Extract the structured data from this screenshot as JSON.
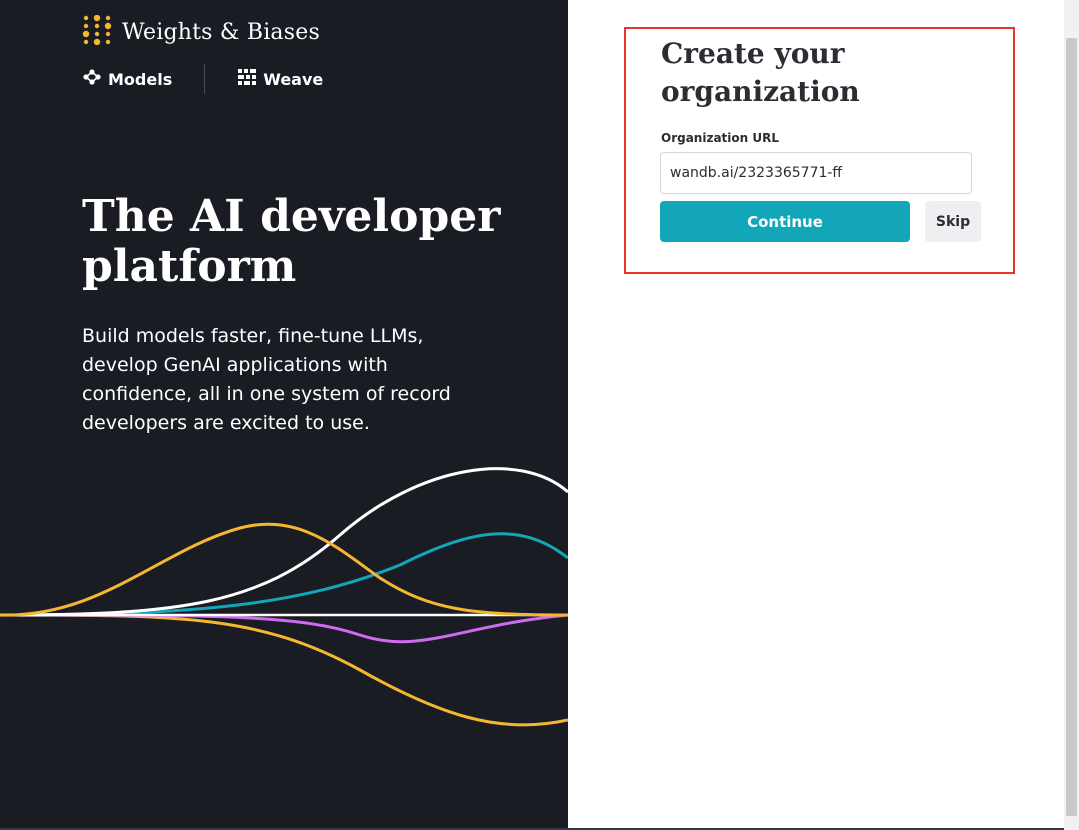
{
  "brand": {
    "name": "Weights & Biases",
    "accent_color": "#f5b731",
    "logo_icon": "wandb-dots-logo-icon"
  },
  "products": [
    {
      "label": "Models",
      "icon": "models-nodes-icon"
    },
    {
      "label": "Weave",
      "icon": "weave-grid-icon"
    }
  ],
  "hero": {
    "headline_line1": "The AI developer",
    "headline_line2": "platform",
    "subtext": "Build models faster, fine-tune LLMs, develop GenAI applications with confidence, all in one system of record developers are excited to use."
  },
  "form": {
    "title_line1": "Create your",
    "title_line2": "organization",
    "field_label": "Organization URL",
    "url_value": "wandb.ai/2323365771-ff",
    "continue_label": "Continue",
    "skip_label": "Skip",
    "primary_color": "#13a5b8",
    "highlight_color": "#e8352c"
  },
  "colors": {
    "left_background": "#1a1c24",
    "wave_white": "#ffffff",
    "wave_yellow": "#f5b731",
    "wave_teal": "#13a5b8",
    "wave_purple": "#cf6bf0"
  }
}
